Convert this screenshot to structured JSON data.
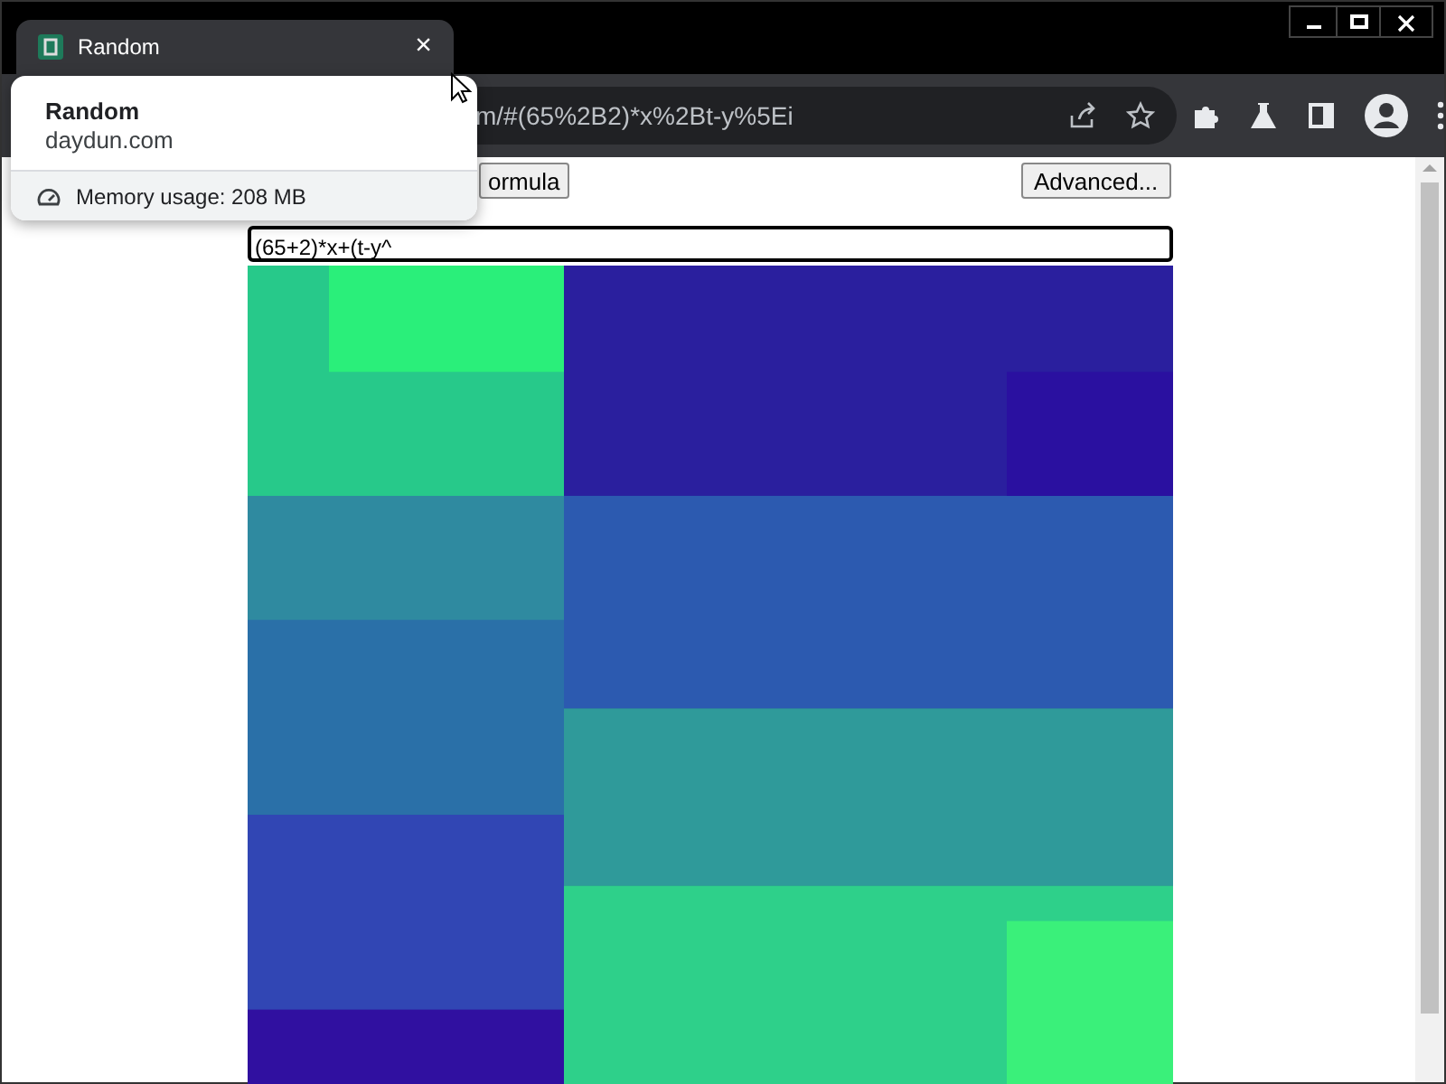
{
  "tab": {
    "title": "Random",
    "close": "×"
  },
  "toolbar": {
    "url": "m/#(65%2B2)*x%2Bt-y%5Ei"
  },
  "hover_card": {
    "title": "Random",
    "domain": "daydun.com",
    "memory": "Memory usage: 208 MB"
  },
  "page": {
    "formula_button": "ormula",
    "advanced_button": "Advanced...",
    "formula_input": "(65+2)*x+(t-y^"
  }
}
